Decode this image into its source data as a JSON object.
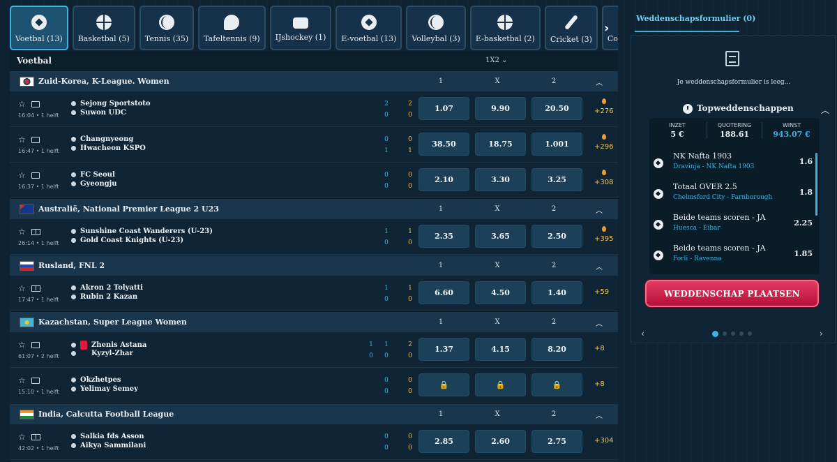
{
  "sports": [
    {
      "label": "Voetbal (13)",
      "icon": "soccer-icon",
      "cls": "ball",
      "active": true
    },
    {
      "label": "Basketbal (5)",
      "icon": "basketball-icon",
      "cls": "basket"
    },
    {
      "label": "Tennis (35)",
      "icon": "tennis-icon",
      "cls": "tennis"
    },
    {
      "label": "Tafeltennis (9)",
      "icon": "table-tennis-icon",
      "cls": "pingpong"
    },
    {
      "label": "IJshockey (1)",
      "icon": "ice-hockey-icon",
      "cls": "puck"
    },
    {
      "label": "E-voetbal (13)",
      "icon": "esoccer-icon",
      "cls": "ball"
    },
    {
      "label": "Volleybal (3)",
      "icon": "volleyball-icon",
      "cls": "tennis"
    },
    {
      "label": "E-basketbal (2)",
      "icon": "ebasketball-icon",
      "cls": "basket"
    },
    {
      "label": "Cricket (3)",
      "icon": "cricket-icon",
      "cls": "cricket"
    },
    {
      "label": "Counter-Strike (",
      "icon": "counter-strike-icon",
      "cls": "cs"
    }
  ],
  "tabs_next": "›",
  "main": {
    "title": "Voetbal",
    "market": "1X2 ⌄"
  },
  "cols": [
    "1",
    "X",
    "2"
  ],
  "collapse": "︿",
  "leagues": [
    {
      "name": "Zuid-Korea, K-League. Women",
      "flag": "kr",
      "matches": [
        {
          "time": "16:04 • 1 helft",
          "t1": "Sejong Sportstoto",
          "t2": "Suwon UDC",
          "half": [
            "2",
            "0"
          ],
          "tot": [
            "2",
            "0"
          ],
          "odds": [
            "1.07",
            "9.90",
            "20.50"
          ],
          "more": "+276",
          "hot": true,
          "icon": "tv"
        },
        {
          "time": "16:47 • 1 helft",
          "t1": "Changnyeong",
          "t2": "Hwacheon KSPO",
          "half": [
            "0",
            "1"
          ],
          "tot": [
            "0",
            "1"
          ],
          "odds": [
            "38.50",
            "18.75",
            "1.001"
          ],
          "more": "+296",
          "hot": true,
          "icon": "tv"
        },
        {
          "time": "16:37 • 1 helft",
          "t1": "FC Seoul",
          "t2": "Gyeongju",
          "half": [
            "0",
            "0"
          ],
          "tot": [
            "0",
            "0"
          ],
          "odds": [
            "2.10",
            "3.30",
            "3.25"
          ],
          "more": "+308",
          "hot": true,
          "icon": "tv"
        }
      ]
    },
    {
      "name": "Australië, National Premier League 2 U23",
      "flag": "au",
      "matches": [
        {
          "time": "26:14 • 1 helft",
          "t1": "Sunshine Coast Wanderers (U-23)",
          "t2": "Gold Coast Knights (U-23)",
          "half": [
            "1",
            "0"
          ],
          "tot": [
            "1",
            "0"
          ],
          "odds": [
            "2.35",
            "3.65",
            "2.50"
          ],
          "more": "+395",
          "hot": true,
          "icon": "pitch"
        }
      ]
    },
    {
      "name": "Rusland, FNL 2",
      "flag": "ru",
      "matches": [
        {
          "time": "17:47 • 1 helft",
          "t1": "Akron 2 Tolyatti",
          "t2": "Rubin 2 Kazan",
          "half": [
            "1",
            "0"
          ],
          "tot": [
            "1",
            "0"
          ],
          "odds": [
            "6.60",
            "4.50",
            "1.40"
          ],
          "more": "+59",
          "hot": false,
          "icon": "pitch"
        }
      ]
    },
    {
      "name": "Kazachstan, Super League Women",
      "flag": "kz",
      "matches": [
        {
          "time": "61:07 • 2 helft",
          "t1": "Zhenis Astana",
          "t2": "Kyzyl-Zhar",
          "pre": [
            "1",
            "0"
          ],
          "half": [
            "1",
            "0"
          ],
          "tot": [
            "2",
            "0"
          ],
          "odds": [
            "1.37",
            "4.15",
            "8.20"
          ],
          "more": "+8",
          "hot": false,
          "icon": "tv",
          "redcard": true
        },
        {
          "time": "15:10 • 1 helft",
          "t1": "Okzhetpes",
          "t2": "Yelimay Semey",
          "half": [
            "0",
            "0"
          ],
          "tot": [
            "0",
            "0"
          ],
          "odds": [
            "🔒",
            "🔒",
            "🔒"
          ],
          "locked": true,
          "more": "+8",
          "hot": false,
          "icon": "tv"
        }
      ]
    },
    {
      "name": "India, Calcutta Football League",
      "flag": "in",
      "matches": [
        {
          "time": "42:02 • 1 helft",
          "t1": "Salkia fds Asson",
          "t2": "Aikya Sammilani",
          "half": [
            "0",
            "0"
          ],
          "tot": [
            "0",
            "0"
          ],
          "odds": [
            "2.85",
            "2.60",
            "2.75"
          ],
          "more": "+304",
          "hot": false,
          "icon": "pitch"
        }
      ]
    }
  ],
  "betslip": {
    "tab": "Weddenschapsformulier (0)",
    "empty": "Je weddenschapsformulier is leeg...",
    "top_title": "Topweddenschappen",
    "collapse": "︿",
    "stake_label": "INZET",
    "stake": "5 €",
    "odds_label": "QUOTERING",
    "odds": "188.61",
    "win_label": "WINST",
    "win": "943.07 €",
    "picks": [
      {
        "title": "NK Nafta 1903",
        "sub": "Dravinja - NK Nafta 1903",
        "odd": "1.6"
      },
      {
        "title": "Totaal OVER 2.5",
        "sub": "Chelmsford City - Farnborough",
        "odd": "1.8"
      },
      {
        "title": "Beide teams scoren - JA",
        "sub": "Huesca - Eibar",
        "odd": "2.25"
      },
      {
        "title": "Beide teams scoren - JA",
        "sub": "Forli - Ravenna",
        "odd": "1.85"
      }
    ],
    "place_label": "WEDDENSCHAP PLAATSEN",
    "nav_left": "‹",
    "nav_right": "›"
  }
}
